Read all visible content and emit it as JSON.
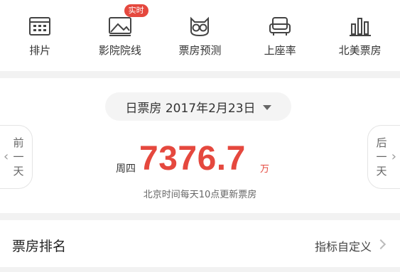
{
  "nav": {
    "items": [
      {
        "label": "排片",
        "icon": "calendar-grid-icon"
      },
      {
        "label": "影院院线",
        "icon": "cinema-screen-icon",
        "badge": "实时"
      },
      {
        "label": "票房预测",
        "icon": "owl-icon"
      },
      {
        "label": "上座率",
        "icon": "seat-icon"
      },
      {
        "label": "北美票房",
        "icon": "bar-chart-icon"
      }
    ]
  },
  "boxoffice": {
    "date_label": "日票房 2017年2月23日",
    "prev_label_1": "前",
    "prev_label_2": "一",
    "prev_label_3": "天",
    "next_label_1": "后",
    "next_label_2": "一",
    "next_label_3": "天",
    "weekday": "周四",
    "amount": "7376.7",
    "unit": "万",
    "note": "北京时间每天10点更新票房"
  },
  "ranking": {
    "title": "票房排名",
    "custom_label": "指标自定义"
  },
  "colors": {
    "accent": "#e5483e",
    "background": "#f2f2f2"
  }
}
